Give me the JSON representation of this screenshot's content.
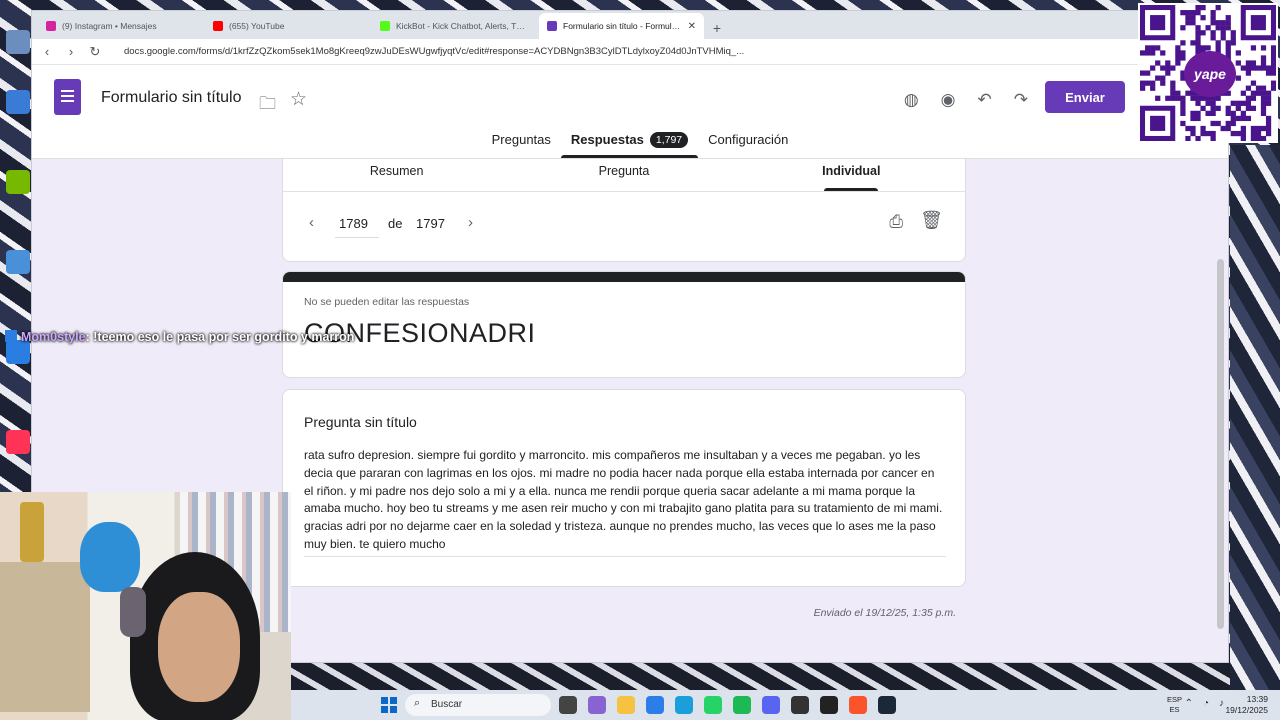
{
  "browser": {
    "tabs": [
      {
        "label": "(9) Instagram • Mensajes",
        "fav_color": "#d6249f",
        "active": false
      },
      {
        "label": "(655) YouTube",
        "fav_color": "#ff0000",
        "active": false
      },
      {
        "label": "KickBot - Kick Chatbot, Alerts, TTS, C",
        "fav_color": "#53fc18",
        "active": false
      },
      {
        "label": "Formulario sin título - Formulario",
        "fav_color": "#673ab7",
        "active": true
      }
    ],
    "url": "docs.google.com/forms/d/1krfZzQZkom5sek1Mo8gKreeq9zwJuDEsWUgwfjyqtVc/edit#response=ACYDBNgn3B3CylDTLdylxoyZ04d0JnTVHMiq_..."
  },
  "form": {
    "title": "Formulario sin título",
    "send_label": "Enviar",
    "tabs": {
      "questions": "Preguntas",
      "responses": "Respuestas",
      "responses_count": "1,797",
      "settings": "Configuración"
    },
    "subtabs": {
      "summary": "Resumen",
      "question": "Pregunta",
      "individual": "Individual"
    },
    "pager": {
      "current": "1789",
      "of": "de",
      "total": "1797"
    },
    "readonly_note": "No se pueden editar las respuestas",
    "response_title": "CONFESIONADRI",
    "question_title": "Pregunta sin título",
    "answer": "rata sufro depresion. siempre fui gordito y marroncito. mis compañeros me insultaban y a veces me pegaban. yo les decia que pararan con lagrimas en los ojos. mi madre no podia hacer nada porque ella estaba internada por cancer en el riñon. y mi padre nos dejo solo a mi y a ella. nunca me rendii porque queria sacar adelante a mi mama porque la amaba mucho. hoy beo tu streams y me asen reir mucho y con mi trabajito gano platita para su tratamiento de mi mami. gracias adri por no dejarme caer en la soledad y tristeza. aunque no prendes mucho, las veces que lo ases me la paso muy bien. te quiero mucho",
    "submitted": "Enviado el 19/12/25, 1:35 p.m."
  },
  "overlay": {
    "chat_user": "Mom0style",
    "chat_message": ": !teemo eso le pasa por ser gordito y marron",
    "qr_brand": "yape"
  },
  "taskbar": {
    "search_placeholder": "Buscar",
    "lang_top": "ESP",
    "lang_bottom": "ES",
    "time": "13:39",
    "date": "19/12/2025"
  },
  "colors": {
    "accent": "#673ab7",
    "page_bg": "#f0ebf8"
  }
}
